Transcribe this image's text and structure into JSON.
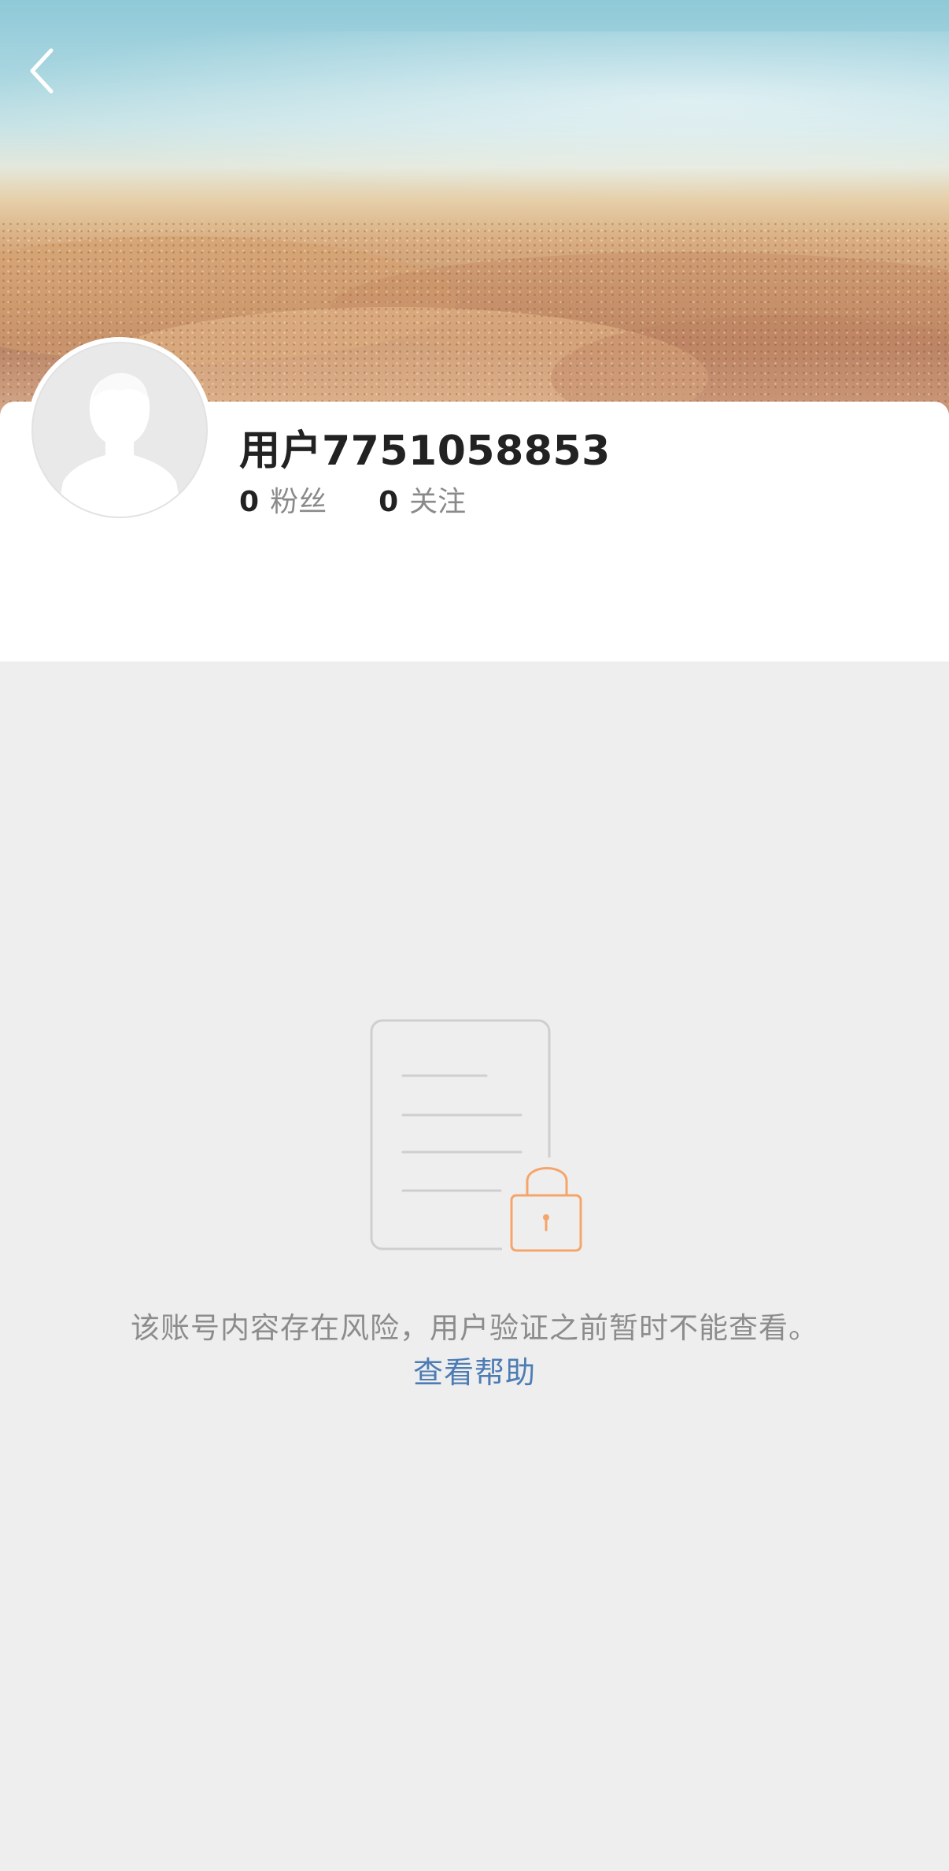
{
  "header": {
    "back_icon": "chevron-left-icon",
    "banner_image": "beach-sand-cover"
  },
  "profile": {
    "username": "用户7751058853",
    "avatar_icon": "default-avatar-icon",
    "stats": [
      {
        "value": "0",
        "label": "粉丝"
      },
      {
        "value": "0",
        "label": "关注"
      }
    ]
  },
  "locked": {
    "illustration_icon": "locked-document-icon",
    "message": "该账号内容存在风险，用户验证之前暂时不能查看。",
    "help_link": "查看帮助",
    "colors": {
      "document_stroke": "#cfcfcf",
      "lock_stroke": "#f5a56b",
      "link": "#4d7cb4",
      "message": "#8c8c8c"
    }
  }
}
